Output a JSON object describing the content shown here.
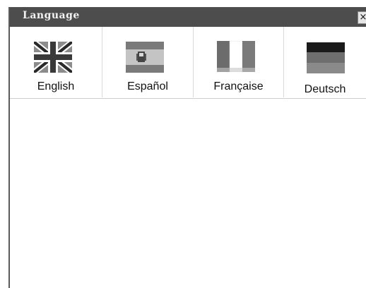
{
  "window": {
    "title": "Language",
    "close_label": "×"
  },
  "languages": [
    {
      "label": "English",
      "icon": "uk-flag-icon"
    },
    {
      "label": "Español",
      "icon": "spain-flag-icon"
    },
    {
      "label": "Française",
      "icon": "france-flag-icon"
    },
    {
      "label": "Deutsch",
      "icon": "germany-flag-icon"
    }
  ]
}
